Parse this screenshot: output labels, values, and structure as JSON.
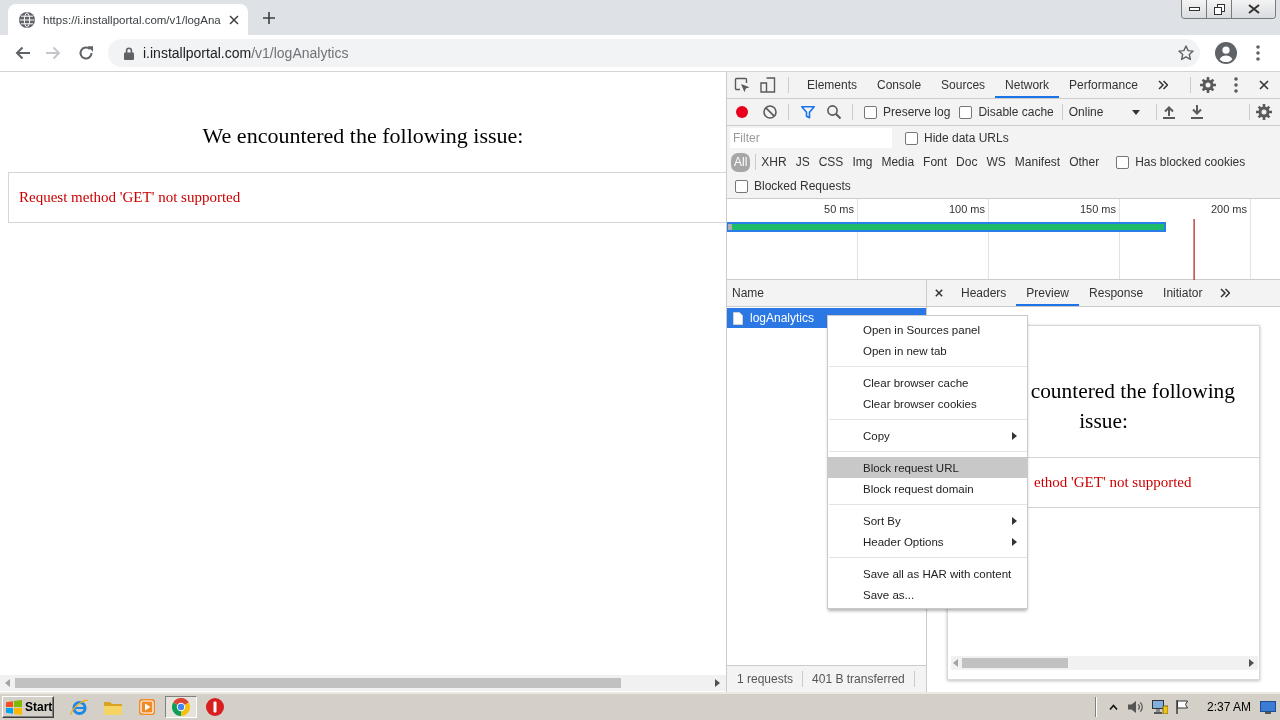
{
  "browser": {
    "tabs": [
      {
        "title": "https://i.installportal.com/v1/logAna",
        "selected": true
      }
    ],
    "nav_buttons": [
      {
        "kind": "back",
        "disabled": false
      },
      {
        "kind": "forward",
        "disabled": true
      },
      {
        "kind": "reload",
        "disabled": false
      }
    ],
    "address_bar": {
      "host": "i.installportal.com",
      "path": "/v1/logAnalytics"
    }
  },
  "page": {
    "heading": "We encountered the following issue:",
    "error": "Request method 'GET' not supported"
  },
  "devtools": {
    "panel_tabs": [
      {
        "label": "Elements",
        "selected": false
      },
      {
        "label": "Console",
        "selected": false
      },
      {
        "label": "Sources",
        "selected": false
      },
      {
        "label": "Network",
        "selected": true
      },
      {
        "label": "Performance",
        "selected": false
      }
    ],
    "toolbar": {
      "recording": true,
      "checkboxes": [
        {
          "label": "Preserve log",
          "checked": false
        },
        {
          "label": "Disable cache",
          "checked": false
        }
      ],
      "throttling": "Online"
    },
    "filter": {
      "placeholder": "Filter",
      "hide_data_urls": {
        "label": "Hide data URLs",
        "checked": false
      }
    },
    "type_filters": [
      {
        "label": "All",
        "selected": true
      },
      {
        "label": "XHR",
        "selected": false
      },
      {
        "label": "JS",
        "selected": false
      },
      {
        "label": "CSS",
        "selected": false
      },
      {
        "label": "Img",
        "selected": false
      },
      {
        "label": "Media",
        "selected": false
      },
      {
        "label": "Font",
        "selected": false
      },
      {
        "label": "Doc",
        "selected": false
      },
      {
        "label": "WS",
        "selected": false
      },
      {
        "label": "Manifest",
        "selected": false
      },
      {
        "label": "Other",
        "selected": false
      }
    ],
    "has_blocked_cookies": {
      "label": "Has blocked cookies",
      "checked": false
    },
    "blocked_requests": {
      "label": "Blocked Requests",
      "checked": false
    },
    "overview": {
      "ticks": [
        "50 ms",
        "100 ms",
        "150 ms",
        "200 ms"
      ]
    },
    "requests": {
      "column": "Name",
      "rows": [
        {
          "name": "logAnalytics",
          "selected": true
        }
      ]
    },
    "summary": [
      "1 requests",
      "401 B transferred"
    ],
    "detail_tabs": [
      {
        "label": "Headers",
        "selected": false
      },
      {
        "label": "Preview",
        "selected": true
      },
      {
        "label": "Response",
        "selected": false
      },
      {
        "label": "Initiator",
        "selected": false
      }
    ],
    "preview": {
      "heading_lines": [
        "countered the following",
        "issue:"
      ],
      "error": "ethod 'GET' not supported"
    },
    "context_menu": {
      "groups": [
        [
          {
            "label": "Open in Sources panel",
            "highlighted": false,
            "submenu": false
          },
          {
            "label": "Open in new tab",
            "highlighted": false,
            "submenu": false
          }
        ],
        [
          {
            "label": "Clear browser cache",
            "highlighted": false,
            "submenu": false
          },
          {
            "label": "Clear browser cookies",
            "highlighted": false,
            "submenu": false
          }
        ],
        [
          {
            "label": "Copy",
            "highlighted": false,
            "submenu": true
          }
        ],
        [
          {
            "label": "Block request URL",
            "highlighted": true,
            "submenu": false
          },
          {
            "label": "Block request domain",
            "highlighted": false,
            "submenu": false
          }
        ],
        [
          {
            "label": "Sort By",
            "highlighted": false,
            "submenu": true
          },
          {
            "label": "Header Options",
            "highlighted": false,
            "submenu": true
          }
        ],
        [
          {
            "label": "Save all as HAR with content",
            "highlighted": false,
            "submenu": false
          },
          {
            "label": "Save as...",
            "highlighted": false,
            "submenu": false
          }
        ]
      ]
    }
  },
  "taskbar": {
    "start": "Start",
    "apps": [
      {
        "kind": "explorer",
        "active": false
      },
      {
        "kind": "folder",
        "active": false
      },
      {
        "kind": "player",
        "active": false
      },
      {
        "kind": "chrome",
        "active": true
      },
      {
        "kind": "stop",
        "active": false
      }
    ],
    "clock": "2:37 AM"
  }
}
